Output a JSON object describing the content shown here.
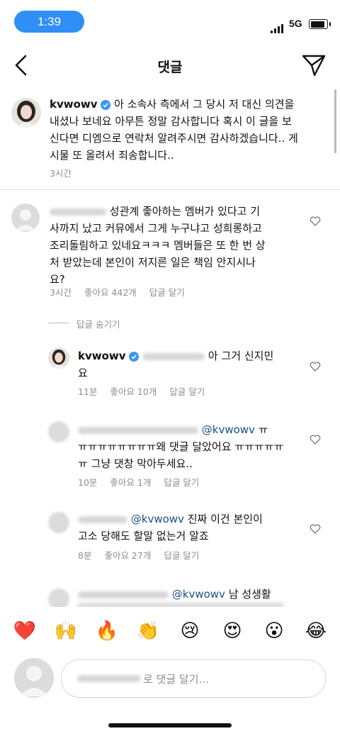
{
  "status_bar": {
    "time": "1:39",
    "network": "5G"
  },
  "header": {
    "title": "댓글"
  },
  "caption": {
    "username": "kvwowv",
    "lines": [
      "아 소속사 측에서 그 당시 저 대신 의견을",
      "내셨나 보네요 아무튼 정말 감사합니다 혹시 이 글을 보",
      "신다면 디엠으로 연락처 알려주시면 감사하겠습니다.. 게",
      "시물 또 올려서 죄송합니다.."
    ],
    "time": "3시간"
  },
  "comments": [
    {
      "lines": [
        "성관계 좋아하는 멤버가 있다고 기",
        "사까지 났고 커뮤에서 그게 누구냐고 성희롱하고",
        "조리돌림하고 있네요ㅋㅋㅋ 멤버들은 또 한 번 상",
        "처 받았는데 본인이 저지른 일은 책임 안지시나",
        "요?"
      ],
      "time": "3시간",
      "likes": "좋아요 442개",
      "reply": "답글 달기"
    }
  ],
  "hide_replies": "답글 숨기기",
  "replies": [
    {
      "username": "kvwowv",
      "lines": [
        "아 그거 신지민",
        "요"
      ],
      "time": "11분",
      "likes": "좋아요 10개",
      "reply": "답글 달기"
    },
    {
      "mention": "@kvwowv",
      "lines": [
        "ㅠ",
        "ㅠㅠㅠㅠㅠㅠㅠㅠ왜 댓글 달았어요 ㅠㅠㅠㅠㅠ",
        "ㅠ 그냥 댓창 막아두세요.."
      ],
      "time": "10분",
      "likes": "좋아요 1개",
      "reply": "답글 달기"
    },
    {
      "mention": "@kvwowv",
      "lines": [
        "진짜 이건 본인이",
        "고소 당해도 할말 없는거 알죠"
      ],
      "time": "8분",
      "likes": "좋아요 27개",
      "reply": "답글 달기"
    },
    {
      "mention": "@kvwowv",
      "lines": [
        "남 성생활"
      ]
    }
  ],
  "emoji_bar": [
    "❤️",
    "🙌",
    "🔥",
    "👏",
    "😢",
    "😍",
    "😮",
    "😂"
  ],
  "input": {
    "placeholder": "로 댓글 달기..."
  },
  "colors": {
    "accent": "#2f8ff7",
    "verified": "#3897f0",
    "mention": "#1a4f8b"
  }
}
